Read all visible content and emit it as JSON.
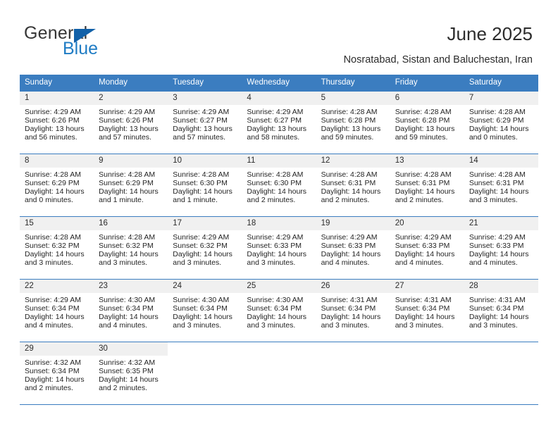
{
  "brand": {
    "name_top": "General",
    "name_bottom": "Blue",
    "triangle_color": "#1160a8",
    "blue_text_color": "#1f7cc4"
  },
  "header": {
    "title": "June 2025",
    "subtitle": "Nosratabad, Sistan and Baluchestan, Iran"
  },
  "theme": {
    "header_row_bg": "#3b7dc0",
    "daynum_bg": "#f0f0f0",
    "grid_line": "#3b7dc0",
    "text": "#242424"
  },
  "calendar": {
    "weekday_headers": [
      "Sunday",
      "Monday",
      "Tuesday",
      "Wednesday",
      "Thursday",
      "Friday",
      "Saturday"
    ],
    "weeks": [
      [
        {
          "day": "1",
          "sunrise": "Sunrise: 4:29 AM",
          "sunset": "Sunset: 6:26 PM",
          "daylight_1": "Daylight: 13 hours",
          "daylight_2": "and 56 minutes."
        },
        {
          "day": "2",
          "sunrise": "Sunrise: 4:29 AM",
          "sunset": "Sunset: 6:26 PM",
          "daylight_1": "Daylight: 13 hours",
          "daylight_2": "and 57 minutes."
        },
        {
          "day": "3",
          "sunrise": "Sunrise: 4:29 AM",
          "sunset": "Sunset: 6:27 PM",
          "daylight_1": "Daylight: 13 hours",
          "daylight_2": "and 57 minutes."
        },
        {
          "day": "4",
          "sunrise": "Sunrise: 4:29 AM",
          "sunset": "Sunset: 6:27 PM",
          "daylight_1": "Daylight: 13 hours",
          "daylight_2": "and 58 minutes."
        },
        {
          "day": "5",
          "sunrise": "Sunrise: 4:28 AM",
          "sunset": "Sunset: 6:28 PM",
          "daylight_1": "Daylight: 13 hours",
          "daylight_2": "and 59 minutes."
        },
        {
          "day": "6",
          "sunrise": "Sunrise: 4:28 AM",
          "sunset": "Sunset: 6:28 PM",
          "daylight_1": "Daylight: 13 hours",
          "daylight_2": "and 59 minutes."
        },
        {
          "day": "7",
          "sunrise": "Sunrise: 4:28 AM",
          "sunset": "Sunset: 6:29 PM",
          "daylight_1": "Daylight: 14 hours",
          "daylight_2": "and 0 minutes."
        }
      ],
      [
        {
          "day": "8",
          "sunrise": "Sunrise: 4:28 AM",
          "sunset": "Sunset: 6:29 PM",
          "daylight_1": "Daylight: 14 hours",
          "daylight_2": "and 0 minutes."
        },
        {
          "day": "9",
          "sunrise": "Sunrise: 4:28 AM",
          "sunset": "Sunset: 6:29 PM",
          "daylight_1": "Daylight: 14 hours",
          "daylight_2": "and 1 minute."
        },
        {
          "day": "10",
          "sunrise": "Sunrise: 4:28 AM",
          "sunset": "Sunset: 6:30 PM",
          "daylight_1": "Daylight: 14 hours",
          "daylight_2": "and 1 minute."
        },
        {
          "day": "11",
          "sunrise": "Sunrise: 4:28 AM",
          "sunset": "Sunset: 6:30 PM",
          "daylight_1": "Daylight: 14 hours",
          "daylight_2": "and 2 minutes."
        },
        {
          "day": "12",
          "sunrise": "Sunrise: 4:28 AM",
          "sunset": "Sunset: 6:31 PM",
          "daylight_1": "Daylight: 14 hours",
          "daylight_2": "and 2 minutes."
        },
        {
          "day": "13",
          "sunrise": "Sunrise: 4:28 AM",
          "sunset": "Sunset: 6:31 PM",
          "daylight_1": "Daylight: 14 hours",
          "daylight_2": "and 2 minutes."
        },
        {
          "day": "14",
          "sunrise": "Sunrise: 4:28 AM",
          "sunset": "Sunset: 6:31 PM",
          "daylight_1": "Daylight: 14 hours",
          "daylight_2": "and 3 minutes."
        }
      ],
      [
        {
          "day": "15",
          "sunrise": "Sunrise: 4:28 AM",
          "sunset": "Sunset: 6:32 PM",
          "daylight_1": "Daylight: 14 hours",
          "daylight_2": "and 3 minutes."
        },
        {
          "day": "16",
          "sunrise": "Sunrise: 4:28 AM",
          "sunset": "Sunset: 6:32 PM",
          "daylight_1": "Daylight: 14 hours",
          "daylight_2": "and 3 minutes."
        },
        {
          "day": "17",
          "sunrise": "Sunrise: 4:29 AM",
          "sunset": "Sunset: 6:32 PM",
          "daylight_1": "Daylight: 14 hours",
          "daylight_2": "and 3 minutes."
        },
        {
          "day": "18",
          "sunrise": "Sunrise: 4:29 AM",
          "sunset": "Sunset: 6:33 PM",
          "daylight_1": "Daylight: 14 hours",
          "daylight_2": "and 3 minutes."
        },
        {
          "day": "19",
          "sunrise": "Sunrise: 4:29 AM",
          "sunset": "Sunset: 6:33 PM",
          "daylight_1": "Daylight: 14 hours",
          "daylight_2": "and 4 minutes."
        },
        {
          "day": "20",
          "sunrise": "Sunrise: 4:29 AM",
          "sunset": "Sunset: 6:33 PM",
          "daylight_1": "Daylight: 14 hours",
          "daylight_2": "and 4 minutes."
        },
        {
          "day": "21",
          "sunrise": "Sunrise: 4:29 AM",
          "sunset": "Sunset: 6:33 PM",
          "daylight_1": "Daylight: 14 hours",
          "daylight_2": "and 4 minutes."
        }
      ],
      [
        {
          "day": "22",
          "sunrise": "Sunrise: 4:29 AM",
          "sunset": "Sunset: 6:34 PM",
          "daylight_1": "Daylight: 14 hours",
          "daylight_2": "and 4 minutes."
        },
        {
          "day": "23",
          "sunrise": "Sunrise: 4:30 AM",
          "sunset": "Sunset: 6:34 PM",
          "daylight_1": "Daylight: 14 hours",
          "daylight_2": "and 4 minutes."
        },
        {
          "day": "24",
          "sunrise": "Sunrise: 4:30 AM",
          "sunset": "Sunset: 6:34 PM",
          "daylight_1": "Daylight: 14 hours",
          "daylight_2": "and 3 minutes."
        },
        {
          "day": "25",
          "sunrise": "Sunrise: 4:30 AM",
          "sunset": "Sunset: 6:34 PM",
          "daylight_1": "Daylight: 14 hours",
          "daylight_2": "and 3 minutes."
        },
        {
          "day": "26",
          "sunrise": "Sunrise: 4:31 AM",
          "sunset": "Sunset: 6:34 PM",
          "daylight_1": "Daylight: 14 hours",
          "daylight_2": "and 3 minutes."
        },
        {
          "day": "27",
          "sunrise": "Sunrise: 4:31 AM",
          "sunset": "Sunset: 6:34 PM",
          "daylight_1": "Daylight: 14 hours",
          "daylight_2": "and 3 minutes."
        },
        {
          "day": "28",
          "sunrise": "Sunrise: 4:31 AM",
          "sunset": "Sunset: 6:34 PM",
          "daylight_1": "Daylight: 14 hours",
          "daylight_2": "and 3 minutes."
        }
      ],
      [
        {
          "day": "29",
          "sunrise": "Sunrise: 4:32 AM",
          "sunset": "Sunset: 6:34 PM",
          "daylight_1": "Daylight: 14 hours",
          "daylight_2": "and 2 minutes."
        },
        {
          "day": "30",
          "sunrise": "Sunrise: 4:32 AM",
          "sunset": "Sunset: 6:35 PM",
          "daylight_1": "Daylight: 14 hours",
          "daylight_2": "and 2 minutes."
        },
        {
          "day": "",
          "sunrise": "",
          "sunset": "",
          "daylight_1": "",
          "daylight_2": ""
        },
        {
          "day": "",
          "sunrise": "",
          "sunset": "",
          "daylight_1": "",
          "daylight_2": ""
        },
        {
          "day": "",
          "sunrise": "",
          "sunset": "",
          "daylight_1": "",
          "daylight_2": ""
        },
        {
          "day": "",
          "sunrise": "",
          "sunset": "",
          "daylight_1": "",
          "daylight_2": ""
        },
        {
          "day": "",
          "sunrise": "",
          "sunset": "",
          "daylight_1": "",
          "daylight_2": ""
        }
      ]
    ]
  }
}
